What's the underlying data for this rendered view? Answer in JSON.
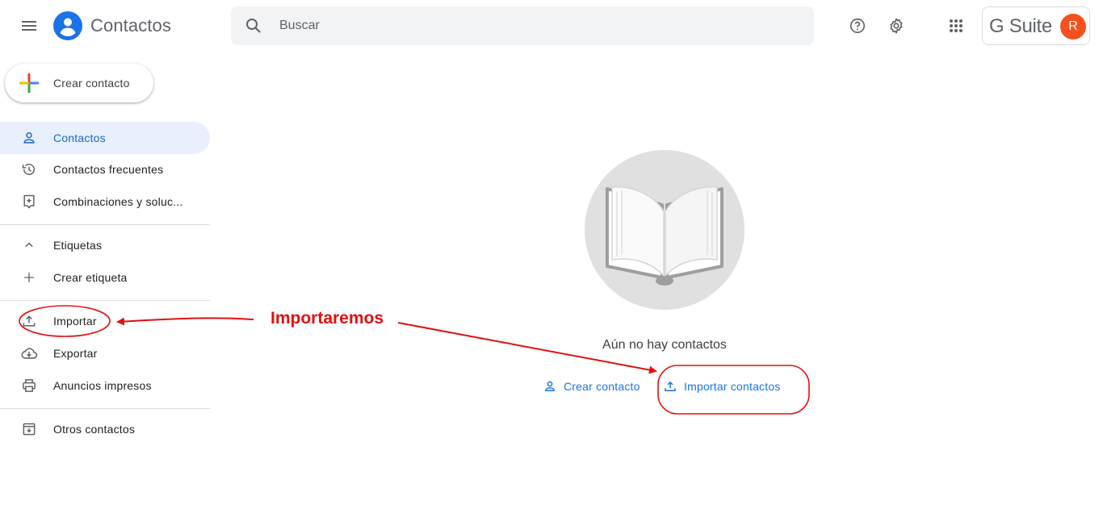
{
  "header": {
    "app_title": "Contactos",
    "search_placeholder": "Buscar",
    "gsuite_label": "G Suite",
    "avatar_initial": "R",
    "icons": [
      "menu-icon",
      "contacts-logo-icon",
      "search-icon",
      "help-icon",
      "settings-icon",
      "apps-grid-icon"
    ]
  },
  "create_button": {
    "label": "Crear contacto"
  },
  "sidebar": {
    "items": [
      {
        "label": "Contactos",
        "icon": "person-icon",
        "active": true
      },
      {
        "label": "Contactos frecuentes",
        "icon": "history-icon"
      },
      {
        "label": "Combinaciones y soluc...",
        "icon": "merge-fix-icon"
      },
      {
        "label": "Etiquetas",
        "icon": "chevron-up-icon"
      },
      {
        "label": "Crear etiqueta",
        "icon": "plus-icon"
      },
      {
        "label": "Importar",
        "icon": "upload-icon"
      },
      {
        "label": "Exportar",
        "icon": "cloud-download-icon"
      },
      {
        "label": "Anuncios impresos",
        "icon": "print-icon"
      },
      {
        "label": "Otros contactos",
        "icon": "archive-icon"
      }
    ]
  },
  "empty_state": {
    "message": "Aún no hay contactos",
    "create_label": "Crear contacto",
    "import_label": "Importar contactos"
  },
  "annotation": {
    "text": "Importaremos",
    "color": "#e01010"
  },
  "colors": {
    "accent": "#1a73e8",
    "active_bg": "#e8f0fe",
    "avatar": "#f4511e"
  }
}
